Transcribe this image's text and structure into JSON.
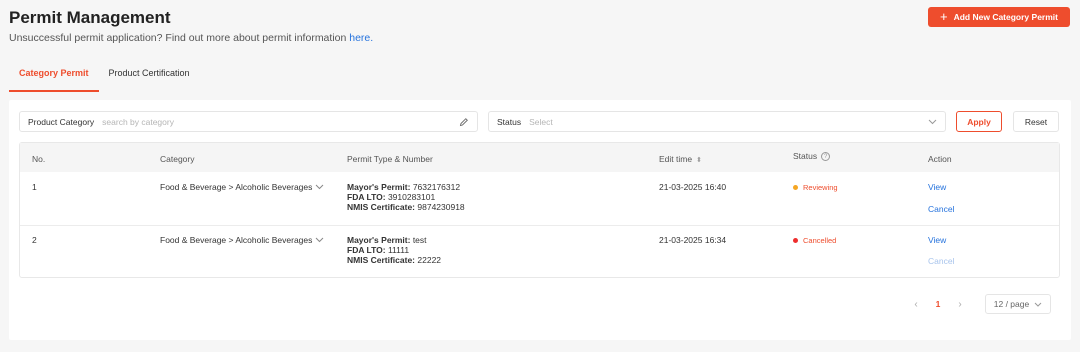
{
  "header": {
    "title": "Permit Management",
    "subtitle_text": "Unsuccessful permit application? Find out more about permit information ",
    "subtitle_link": "here.",
    "add_button": "Add New Category Permit"
  },
  "tabs": [
    {
      "label": "Category Permit",
      "active": true
    },
    {
      "label": "Product Certification",
      "active": false
    }
  ],
  "filters": {
    "category_label": "Product Category",
    "category_placeholder": "search by category",
    "status_label": "Status",
    "status_placeholder": "Select",
    "apply": "Apply",
    "reset": "Reset"
  },
  "table": {
    "columns": [
      "No.",
      "Category",
      "Permit Type & Number",
      "Edit time",
      "Status",
      "Action"
    ],
    "rows": [
      {
        "no": "1",
        "category": "Food & Beverage > Alcoholic Beverages",
        "permits": [
          {
            "label": "Mayor's Permit:",
            "value": "7632176312"
          },
          {
            "label": "FDA LTO:",
            "value": "3910283101"
          },
          {
            "label": "NMIS Certificate:",
            "value": "9874230918"
          }
        ],
        "edit_time": "21-03-2025 16:40",
        "status": "Reviewing",
        "status_color": "#f5a623",
        "actions": [
          "View",
          "Cancel"
        ],
        "cancel_enabled": true
      },
      {
        "no": "2",
        "category": "Food & Beverage > Alcoholic Beverages",
        "permits": [
          {
            "label": "Mayor's Permit:",
            "value": "test"
          },
          {
            "label": "FDA LTO:",
            "value": "11111"
          },
          {
            "label": "NMIS Certificate:",
            "value": "22222"
          }
        ],
        "edit_time": "21-03-2025 16:34",
        "status": "Cancelled",
        "status_color": "#ee2d2d",
        "actions": [
          "View",
          "Cancel"
        ],
        "cancel_enabled": false
      }
    ]
  },
  "pagination": {
    "current_page": "1",
    "page_size": "12 / page"
  },
  "colors": {
    "accent": "#ee4d2d",
    "link": "#2673dd"
  }
}
